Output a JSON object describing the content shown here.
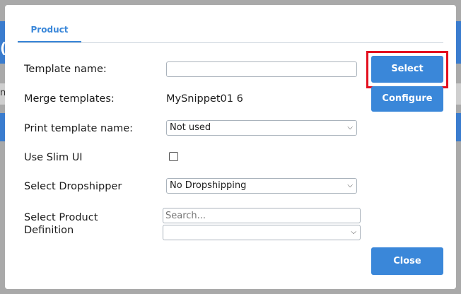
{
  "modal": {
    "tab_product": "Product",
    "fields": {
      "template_name_label": "Template name:",
      "template_name_value": "",
      "merge_templates_label": "Merge templates:",
      "merge_templates_value": "MySnippet01 6",
      "print_template_label": "Print template name:",
      "print_template_value": "Not used",
      "slim_ui_label": "Use Slim UI",
      "dropshipper_label": "Select Dropshipper",
      "dropshipper_value": "No Dropshipping",
      "product_definition_label_line1": "Select Product",
      "product_definition_label_line2": "Definition",
      "product_definition_search_placeholder": "Search...",
      "product_definition_value": ""
    },
    "buttons": {
      "select": "Select",
      "configure": "Configure",
      "close": "Close"
    }
  },
  "background": {
    "glyph1": "(",
    "glyph2": "n"
  },
  "colors": {
    "accent": "#3a87d9",
    "highlight": "#e3101f"
  }
}
